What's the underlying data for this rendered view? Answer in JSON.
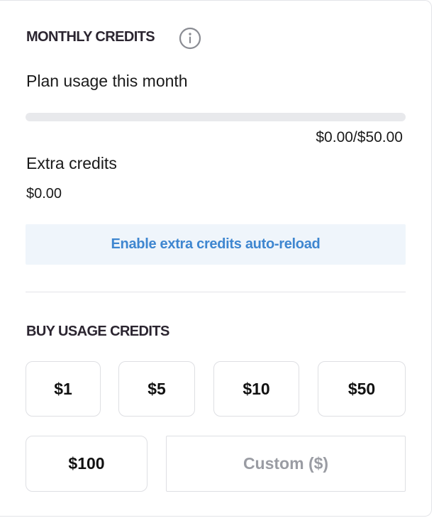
{
  "monthly": {
    "title": "MONTHLY CREDITS",
    "info_icon": "info-icon",
    "plan_label": "Plan usage this month",
    "usage_fraction": 0,
    "usage_text": "$0.00/$50.00"
  },
  "extra": {
    "label": "Extra credits",
    "amount": "$0.00",
    "auto_reload_label": "Enable extra credits auto-reload"
  },
  "buy": {
    "title": "BUY USAGE CREDITS",
    "amounts": [
      "$1",
      "$5",
      "$10",
      "$50",
      "$100"
    ],
    "custom_placeholder": "Custom ($)"
  },
  "colors": {
    "accent": "#3e86d0",
    "accent_bg": "#eff5fb",
    "muted": "#9a9ca3",
    "track": "#e8e9ec"
  }
}
